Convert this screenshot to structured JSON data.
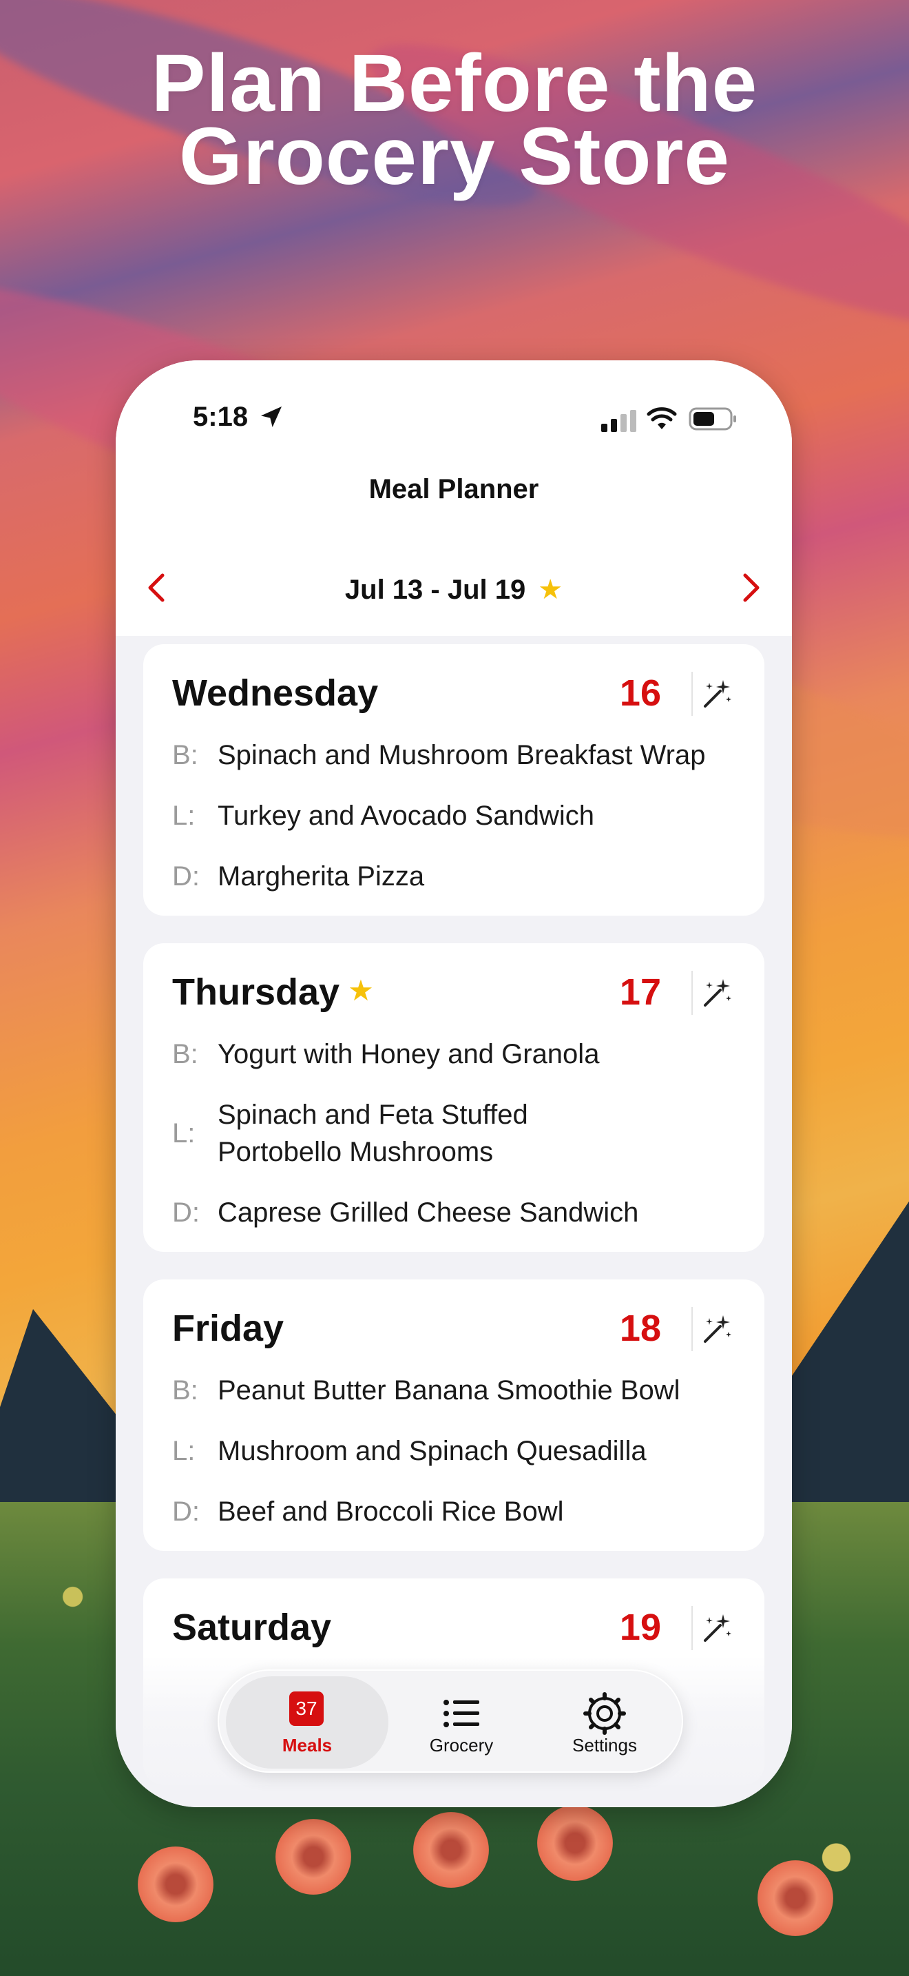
{
  "headline": {
    "line1": "Plan Before the",
    "line2": "Grocery Store"
  },
  "status_bar": {
    "time": "5:18"
  },
  "nav": {
    "title": "Meal Planner"
  },
  "week": {
    "label": "Jul 13 - Jul 19",
    "starred": true
  },
  "days": [
    {
      "name": "Wednesday",
      "date": "16",
      "starred": false,
      "meals": [
        {
          "label": "B:",
          "text": "Spinach and Mushroom Breakfast Wrap"
        },
        {
          "label": "L:",
          "text": "Turkey and Avocado Sandwich"
        },
        {
          "label": "D:",
          "text": "Margherita Pizza"
        }
      ]
    },
    {
      "name": "Thursday",
      "date": "17",
      "starred": true,
      "meals": [
        {
          "label": "B:",
          "text": "Yogurt with Honey and Granola"
        },
        {
          "label": "L:",
          "text": "Spinach and Feta Stuffed Portobello Mushrooms"
        },
        {
          "label": "D:",
          "text": "Caprese Grilled Cheese Sandwich"
        }
      ]
    },
    {
      "name": "Friday",
      "date": "18",
      "starred": false,
      "meals": [
        {
          "label": "B:",
          "text": "Peanut Butter Banana Smoothie Bowl"
        },
        {
          "label": "L:",
          "text": "Mushroom and Spinach Quesadilla"
        },
        {
          "label": "D:",
          "text": "Beef and Broccoli Rice Bowl"
        }
      ]
    },
    {
      "name": "Saturday",
      "date": "19",
      "starred": false,
      "meals": []
    }
  ],
  "tabs": {
    "meals": {
      "label": "Meals",
      "badge": "37"
    },
    "grocery": {
      "label": "Grocery"
    },
    "settings": {
      "label": "Settings"
    }
  },
  "colors": {
    "accent": "#d60f10",
    "star": "#f6c10a"
  },
  "icons": {
    "location": "location-arrow-icon",
    "signal": "signal-icon",
    "wifi": "wifi-icon",
    "battery": "battery-icon",
    "prev": "chevron-left-icon",
    "next": "chevron-right-icon",
    "magic": "magic-wand-icon",
    "grocery": "list-icon",
    "settings": "gear-icon"
  }
}
